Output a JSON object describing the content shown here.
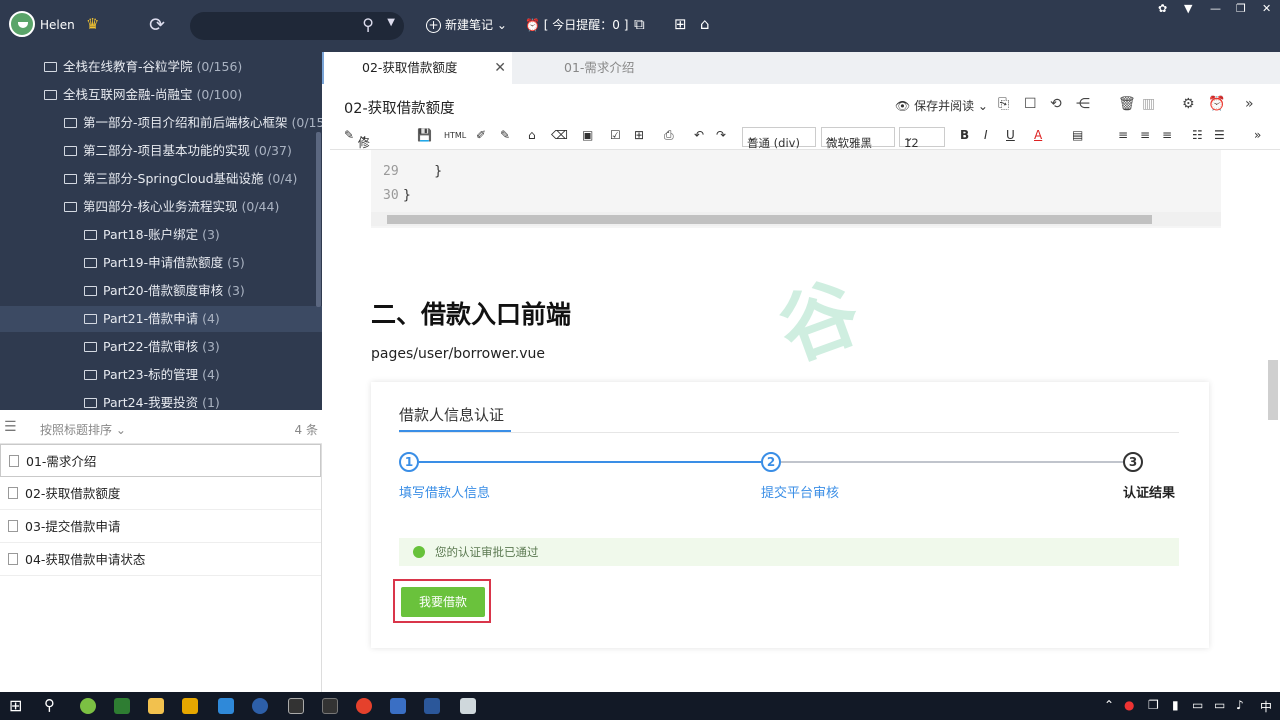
{
  "topbar": {
    "username": "Helen",
    "new_note": "新建笔记",
    "reminder": "[ 今日提醒：0 ]"
  },
  "sidebar": {
    "items": [
      {
        "label": "全栈在线教育-谷粒学院",
        "count": "(0/156)"
      },
      {
        "label": "全栈互联网金融-尚融宝",
        "count": "(0/100)"
      },
      {
        "label": "第一部分-项目介绍和前后端核心框架",
        "count": "(0/15"
      },
      {
        "label": "第二部分-项目基本功能的实现",
        "count": "(0/37)"
      },
      {
        "label": "第三部分-SpringCloud基础设施",
        "count": "(0/4)"
      },
      {
        "label": "第四部分-核心业务流程实现",
        "count": "(0/44)"
      },
      {
        "label": "Part18-账户绑定",
        "count": "(3)"
      },
      {
        "label": "Part19-申请借款额度",
        "count": "(5)"
      },
      {
        "label": "Part20-借款额度审核",
        "count": "(3)"
      },
      {
        "label": "Part21-借款申请",
        "count": "(4)"
      },
      {
        "label": "Part22-借款审核",
        "count": "(3)"
      },
      {
        "label": "Part23-标的管理",
        "count": "(4)"
      },
      {
        "label": "Part24-我要投资",
        "count": "(1)"
      }
    ]
  },
  "sort": {
    "label": "按照标题排序",
    "count": "4 条"
  },
  "notes": [
    "01-需求介绍",
    "02-获取借款额度",
    "03-提交借款申请",
    "04-获取借款申请状态"
  ],
  "tabs": {
    "active": "02-获取借款额度",
    "other": "01-需求介绍"
  },
  "editor": {
    "title": "02-获取借款额度",
    "save_readonly": "保存并阅读",
    "toolbar": {
      "revise": "修订",
      "block": "普通 (div)",
      "font": "微软雅黑",
      "size": "12"
    }
  },
  "doc": {
    "code_lines": [
      {
        "num": "29",
        "text": "    }"
      },
      {
        "num": "30",
        "text": "}"
      }
    ],
    "heading": "二、借款入口前端",
    "path": "pages/user/borrower.vue",
    "card": {
      "title": "借款人信息认证",
      "steps": [
        {
          "num": "1",
          "label": "填写借款人信息"
        },
        {
          "num": "2",
          "label": "提交平台审核"
        },
        {
          "num": "3",
          "label": "认证结果"
        }
      ],
      "success_msg": "您的认证审批已通过",
      "button": "我要借款"
    }
  },
  "taskbar": {
    "ime": "中"
  }
}
